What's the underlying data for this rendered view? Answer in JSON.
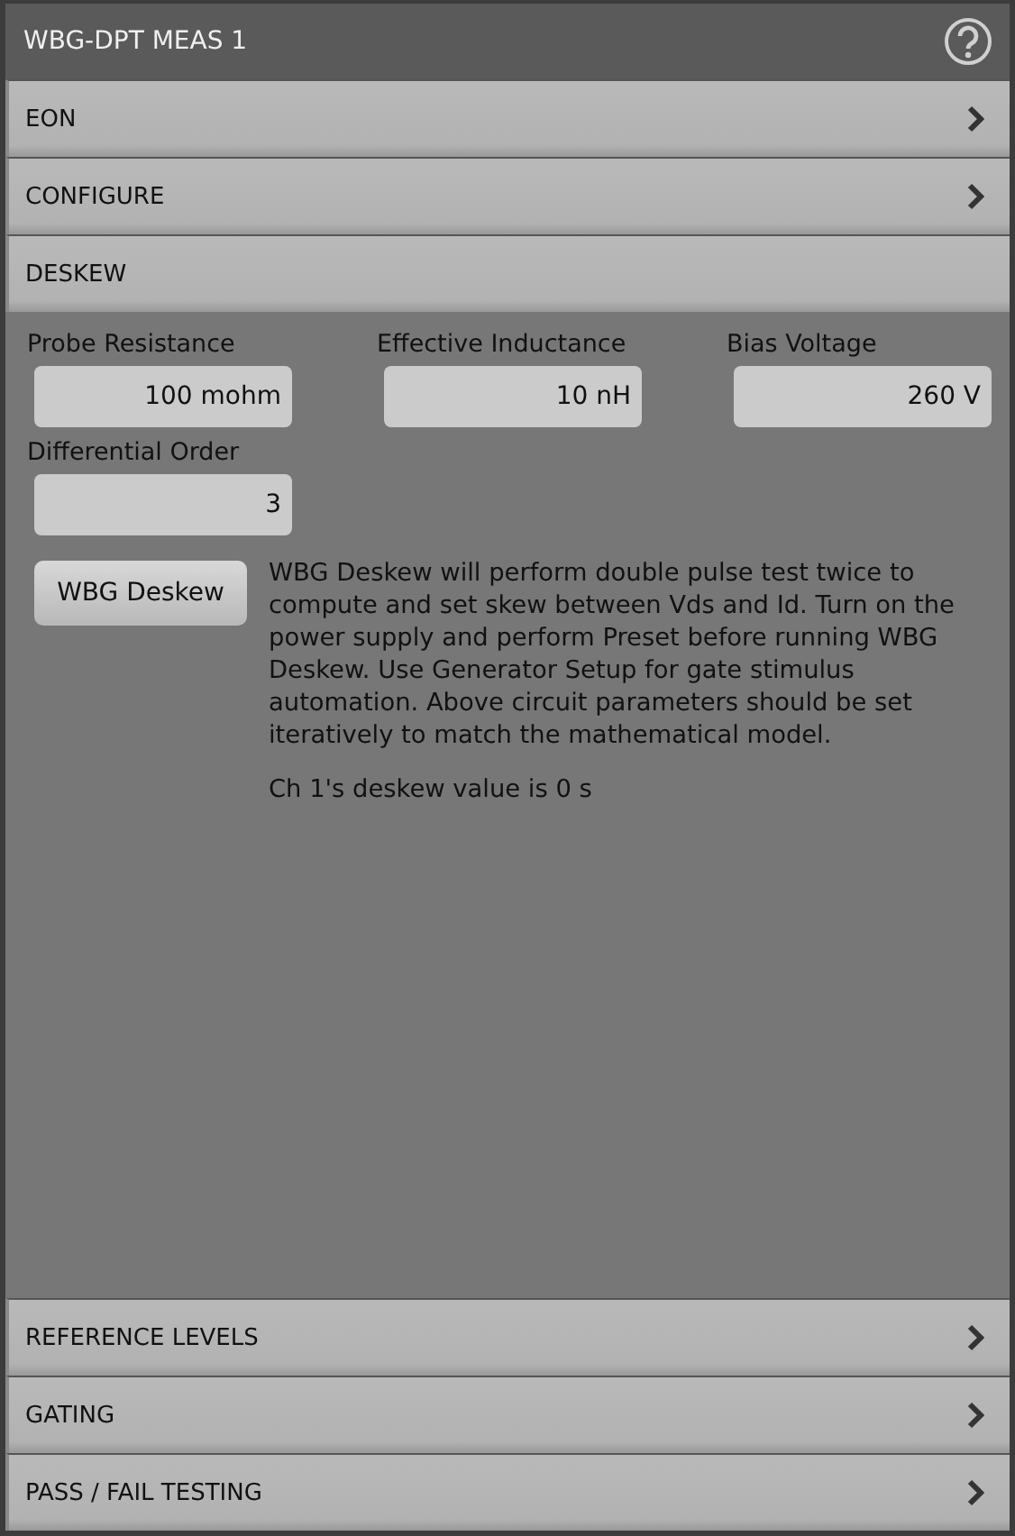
{
  "panel": {
    "title": "WBG-DPT MEAS 1"
  },
  "sections_top": [
    {
      "label": "EON",
      "expanded": false
    },
    {
      "label": "CONFIGURE",
      "expanded": false
    },
    {
      "label": "DESKEW",
      "expanded": true
    }
  ],
  "deskew": {
    "fields": [
      {
        "label": "Probe Resistance",
        "value": "100 mohm"
      },
      {
        "label": "Effective Inductance",
        "value": "10 nH"
      },
      {
        "label": "Bias Voltage",
        "value": "260 V"
      },
      {
        "label": "Differential Order",
        "value": "3"
      }
    ],
    "button": "WBG Deskew",
    "description": "WBG Deskew will perform double pulse test twice to compute and set skew between Vds and Id. Turn on the power supply and perform Preset before running WBG Deskew. Use Generator Setup for gate stimulus automation. Above circuit parameters should be set iteratively to match the mathematical model.",
    "status": "Ch 1's deskew value is 0 s"
  },
  "sections_bottom": [
    {
      "label": "REFERENCE LEVELS",
      "expanded": false
    },
    {
      "label": "GATING",
      "expanded": false
    },
    {
      "label": "PASS / FAIL TESTING",
      "expanded": false
    }
  ]
}
